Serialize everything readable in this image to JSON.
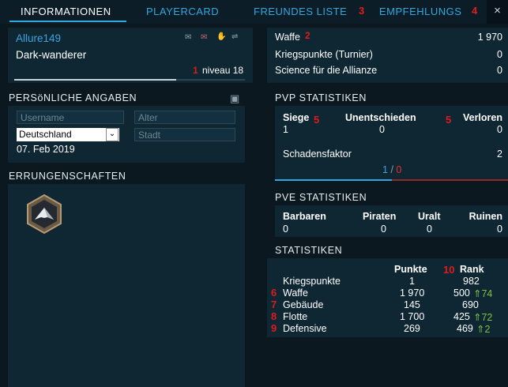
{
  "tabs": [
    {
      "label": "INFORMATIONEN",
      "marker": ""
    },
    {
      "label": "PLAYERCARD",
      "marker": ""
    },
    {
      "label": "FREUNDES LISTE",
      "marker": "3"
    },
    {
      "label": "EMPFEHLUNGS",
      "marker": "4"
    }
  ],
  "close_label": "×",
  "profile": {
    "name": "Allure149",
    "alliance": "Dark-wanderer",
    "level_marker": "1",
    "level_label": "niveau 18"
  },
  "stats_top": [
    {
      "label": "Waffe",
      "marker": "2",
      "value": "1 970"
    },
    {
      "label": "Kriegspunkte (Turnier)",
      "marker": "",
      "value": "0"
    },
    {
      "label": "Science für die Allianze",
      "marker": "",
      "value": "0"
    }
  ],
  "personal": {
    "title": "PERSöNLICHE ANGABEN",
    "username_placeholder": "Username",
    "age_placeholder": "Alter",
    "country": "Deutschland",
    "city_placeholder": "Stadt",
    "date": "07. Feb 2019"
  },
  "achievements": {
    "title": "ERRUNGENSCHAFTEN"
  },
  "pvp": {
    "title": "PVP STATISTIKEN",
    "headers": [
      "Siege",
      "Unentschieden",
      "Verloren"
    ],
    "markers": [
      "5",
      "5"
    ],
    "values": [
      "1",
      "0",
      "0"
    ],
    "damage_label": "Schadensfaktor",
    "damage_value": "2",
    "ratio_win": "1",
    "ratio_sep": "/",
    "ratio_loss": "0"
  },
  "pve": {
    "title": "PVE STATISTIKEN",
    "headers": [
      "Barbaren",
      "Piraten",
      "Uralt",
      "Ruinen"
    ],
    "values": [
      "0",
      "0",
      "0",
      "0"
    ]
  },
  "stats": {
    "title": "STATISTIKEN",
    "col_points": "Punkte",
    "col_rank": "Rank",
    "rank_marker": "10",
    "rows": [
      {
        "marker": "",
        "label": "Kriegspunkte",
        "points": "1",
        "rank": "982",
        "change": ""
      },
      {
        "marker": "6",
        "label": "Waffe",
        "points": "1 970",
        "rank": "500",
        "change": "⇑74"
      },
      {
        "marker": "7",
        "label": "Gebäude",
        "points": "145",
        "rank": "690",
        "change": ""
      },
      {
        "marker": "8",
        "label": "Flotte",
        "points": "1 700",
        "rank": "425",
        "change": "⇑72"
      },
      {
        "marker": "9",
        "label": "Defensive",
        "points": "269",
        "rank": "469",
        "change": "⇑2"
      }
    ]
  },
  "colors": {
    "accent": "#2ea8df",
    "marker": "#e01b1b",
    "panel": "#0f2633",
    "background": "#0b1820",
    "up": "#7fc241"
  }
}
